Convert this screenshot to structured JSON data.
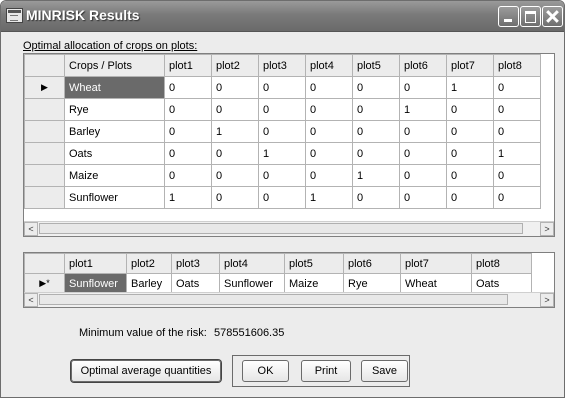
{
  "window": {
    "title": "MINRISK Results"
  },
  "caption": "Optimal allocation of crops on plots:",
  "grid1": {
    "corner": "Crops / Plots",
    "columns": [
      "plot1",
      "plot2",
      "plot3",
      "plot4",
      "plot5",
      "plot6",
      "plot7",
      "plot8"
    ],
    "current_row_marker": "▶",
    "rows": [
      {
        "crop": "Wheat",
        "values": [
          "0",
          "0",
          "0",
          "0",
          "0",
          "0",
          "1",
          "0"
        ]
      },
      {
        "crop": "Rye",
        "values": [
          "0",
          "0",
          "0",
          "0",
          "0",
          "1",
          "0",
          "0"
        ]
      },
      {
        "crop": "Barley",
        "values": [
          "0",
          "1",
          "0",
          "0",
          "0",
          "0",
          "0",
          "0"
        ]
      },
      {
        "crop": "Oats",
        "values": [
          "0",
          "0",
          "1",
          "0",
          "0",
          "0",
          "0",
          "1"
        ]
      },
      {
        "crop": "Maize",
        "values": [
          "0",
          "0",
          "0",
          "0",
          "1",
          "0",
          "0",
          "0"
        ]
      },
      {
        "crop": "Sunflower",
        "values": [
          "1",
          "0",
          "0",
          "1",
          "0",
          "0",
          "0",
          "0"
        ]
      }
    ]
  },
  "grid2": {
    "columns": [
      "plot1",
      "plot2",
      "plot3",
      "plot4",
      "plot5",
      "plot6",
      "plot7",
      "plot8"
    ],
    "new_row_marker": "▶*",
    "row": [
      "Sunflower",
      "Barley",
      "Oats",
      "Sunflower",
      "Maize",
      "Rye",
      "Wheat",
      "Oats"
    ]
  },
  "risk": {
    "label": "Minimum value of the risk:",
    "value": "578551606.35"
  },
  "buttons": {
    "avg": "Optimal average quantities",
    "ok": "OK",
    "print": "Print",
    "save": "Save"
  },
  "scroll_arrows": {
    "left": "<",
    "right": ">"
  },
  "icons": {
    "app": "app-window-icon",
    "minimize": "minimize-icon",
    "maximize": "maximize-icon",
    "close": "close-icon"
  }
}
